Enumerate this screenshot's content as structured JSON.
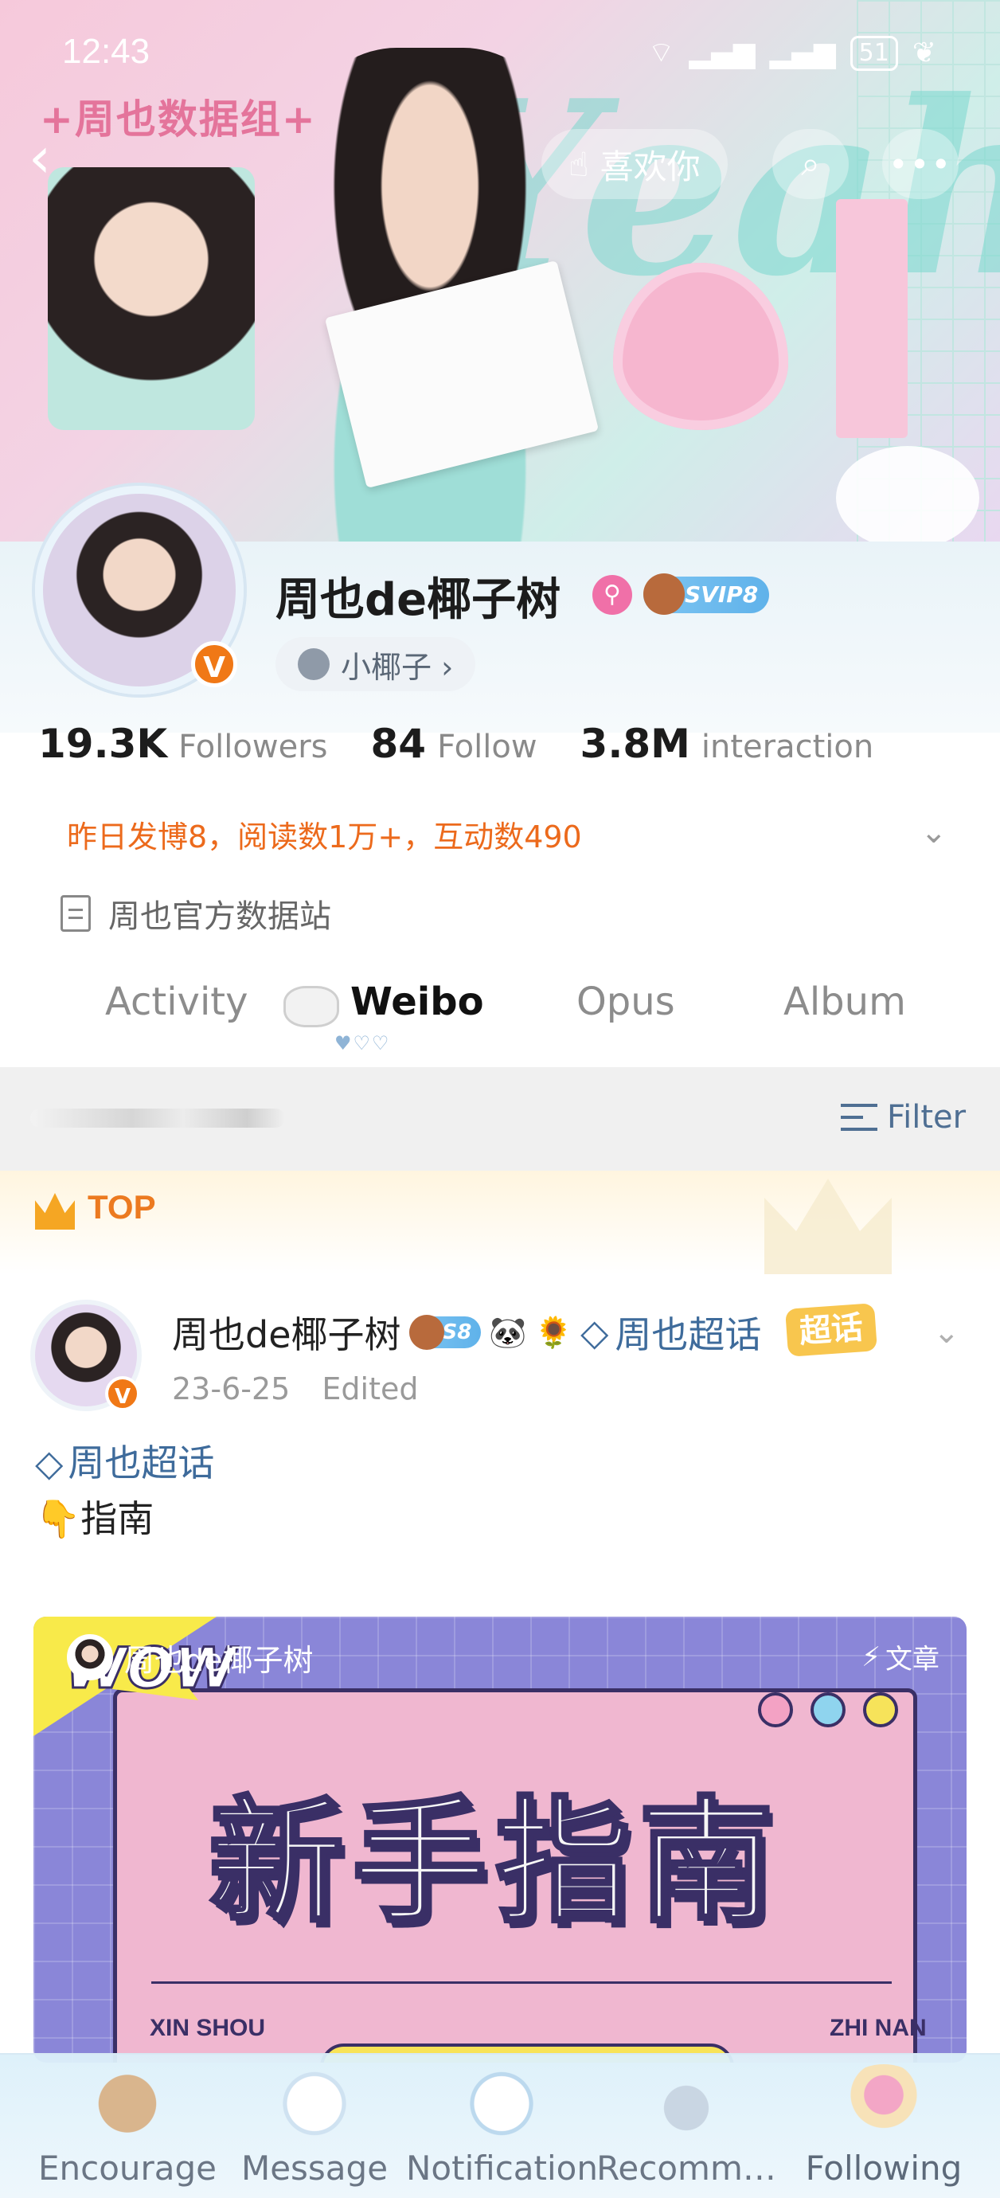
{
  "status_bar": {
    "time": "12:43",
    "battery": "51"
  },
  "header": {
    "banner_title": "+周也数据组+",
    "banner_word": "Yeah",
    "like_button_label": "喜欢你"
  },
  "profile": {
    "name": "周也de椰子树",
    "vip_badge": "SVIP8",
    "fan_group": "小椰子 ›",
    "stats": [
      {
        "value": "19.3K",
        "label": "Followers"
      },
      {
        "value": "84",
        "label": "Follow"
      },
      {
        "value": "3.8M",
        "label": "interaction"
      }
    ],
    "notice": "昨日发博8，阅读数1万+，互动数490",
    "description": "周也官方数据站"
  },
  "tabs": [
    {
      "label": "Activity"
    },
    {
      "label": "Weibo",
      "selected": true
    },
    {
      "label": "Opus"
    },
    {
      "label": "Album"
    }
  ],
  "filter": {
    "label": "Filter"
  },
  "pinned": {
    "label": "TOP"
  },
  "post": {
    "author": "周也de椰子树",
    "author_badge": "S8",
    "topic_name": "周也超话",
    "topic_tag": "超话",
    "date": "23-6-25",
    "edited": "Edited",
    "body_topic": "周也超话",
    "body_line2": "👇指南",
    "card": {
      "author": "周也de椰子树",
      "type": "文章",
      "wow": "WOW",
      "title": "新手指南",
      "sub_left": "XIN SHOU",
      "sub_right": "ZHI NAN"
    }
  },
  "bottom_nav": [
    {
      "label": "Encourage"
    },
    {
      "label": "Message"
    },
    {
      "label": "Notification"
    },
    {
      "label": "Recomm…"
    },
    {
      "label": "Following"
    }
  ],
  "colors": {
    "accent_orange": "#ec6a1c",
    "link_blue": "#3e6b9b",
    "verified_orange": "#f07816",
    "vip_blue": "#5fb2ea"
  }
}
